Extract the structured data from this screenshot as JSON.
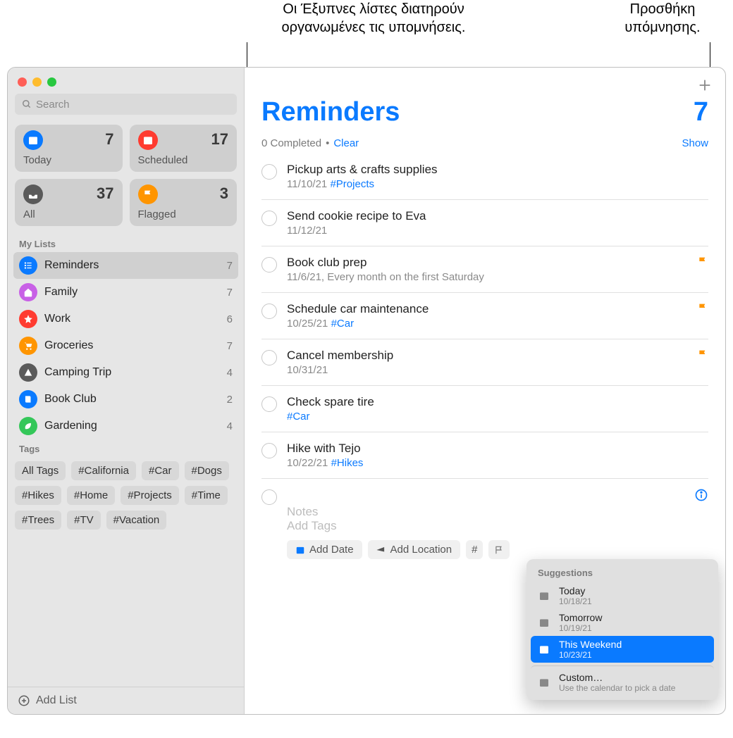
{
  "callouts": {
    "smart_lists": "Οι Έξυπνες λίστες διατηρούν οργανωμένες τις υπομνήσεις.",
    "add_reminder": "Προσθήκη υπόμνησης."
  },
  "search": {
    "placeholder": "Search"
  },
  "smart_cards": {
    "today": {
      "label": "Today",
      "count": "7",
      "color": "#0a7aff",
      "icon": "calendar"
    },
    "scheduled": {
      "label": "Scheduled",
      "count": "17",
      "color": "#ff3b30",
      "icon": "calendar"
    },
    "all": {
      "label": "All",
      "count": "37",
      "color": "#5a5a5a",
      "icon": "tray"
    },
    "flagged": {
      "label": "Flagged",
      "count": "3",
      "color": "#ff9500",
      "icon": "flag"
    }
  },
  "my_lists_title": "My Lists",
  "lists": [
    {
      "name": "Reminders",
      "count": "7",
      "color": "#0a7aff",
      "icon": "list",
      "selected": true
    },
    {
      "name": "Family",
      "count": "7",
      "color": "#c860e6",
      "icon": "house",
      "selected": false
    },
    {
      "name": "Work",
      "count": "6",
      "color": "#ff3b30",
      "icon": "star",
      "selected": false
    },
    {
      "name": "Groceries",
      "count": "7",
      "color": "#ff9500",
      "icon": "cart",
      "selected": false
    },
    {
      "name": "Camping Trip",
      "count": "4",
      "color": "#5a5a5a",
      "icon": "tent",
      "selected": false
    },
    {
      "name": "Book Club",
      "count": "2",
      "color": "#0a7aff",
      "icon": "book",
      "selected": false
    },
    {
      "name": "Gardening",
      "count": "4",
      "color": "#34c759",
      "icon": "leaf",
      "selected": false
    }
  ],
  "tags_title": "Tags",
  "tags": [
    "All Tags",
    "#California",
    "#Car",
    "#Dogs",
    "#Hikes",
    "#Home",
    "#Projects",
    "#Time",
    "#Trees",
    "#TV",
    "#Vacation"
  ],
  "add_list_label": "Add List",
  "header": {
    "title": "Reminders",
    "count": "7",
    "completed_text": "0 Completed",
    "dot": "•",
    "clear_label": "Clear",
    "show_label": "Show"
  },
  "reminders": [
    {
      "title": "Pickup arts & crafts supplies",
      "date": "11/10/21",
      "tag": "#Projects",
      "flagged": false
    },
    {
      "title": "Send cookie recipe to Eva",
      "date": "11/12/21",
      "tag": "",
      "flagged": false
    },
    {
      "title": "Book club prep",
      "date": "11/6/21, Every month on the first Saturday",
      "tag": "",
      "flagged": true
    },
    {
      "title": "Schedule car maintenance",
      "date": "10/25/21",
      "tag": "#Car",
      "flagged": true
    },
    {
      "title": "Cancel membership",
      "date": "10/31/21",
      "tag": "",
      "flagged": true
    },
    {
      "title": "Check spare tire",
      "date": "",
      "tag": "#Car",
      "flagged": false
    },
    {
      "title": "Hike with Tejo",
      "date": "10/22/21",
      "tag": "#Hikes",
      "flagged": false
    }
  ],
  "new_reminder": {
    "notes_placeholder": "Notes",
    "add_tags_placeholder": "Add Tags",
    "add_date_label": "Add Date",
    "add_location_label": "Add Location"
  },
  "date_popover": {
    "header": "Suggestions",
    "options": [
      {
        "title": "Today",
        "sub": "10/18/21",
        "selected": false
      },
      {
        "title": "Tomorrow",
        "sub": "10/19/21",
        "selected": false
      },
      {
        "title": "This Weekend",
        "sub": "10/23/21",
        "selected": true
      }
    ],
    "custom": {
      "title": "Custom…",
      "sub": "Use the calendar to pick a date"
    }
  }
}
